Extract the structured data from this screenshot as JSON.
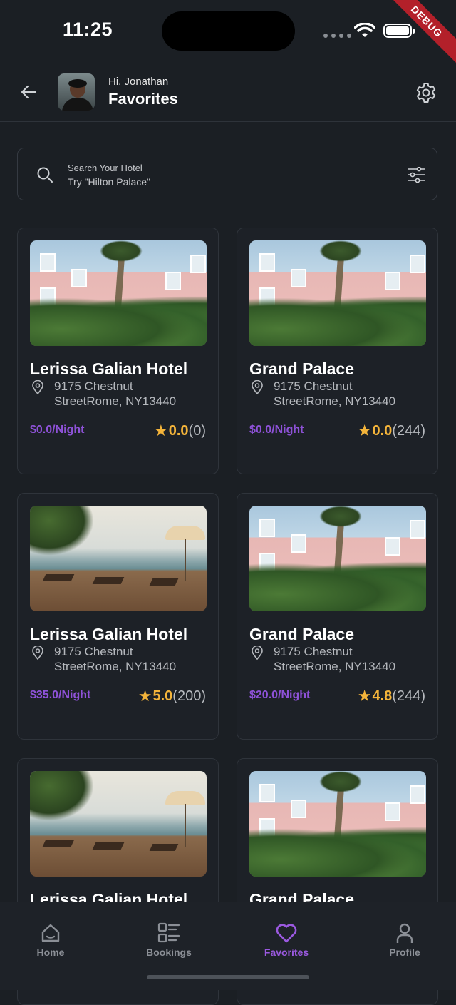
{
  "status_bar": {
    "time": "11:25",
    "debug_label": "DEBUG"
  },
  "header": {
    "greeting": "Hi, Jonathan",
    "title": "Favorites"
  },
  "search": {
    "label": "Search Your Hotel",
    "placeholder": "Try \"Hilton Palace\""
  },
  "hotels": [
    {
      "name": "Lerissa Galian Hotel",
      "address_line1": "9175 Chestnut",
      "address_line2": "StreetRome, NY13440",
      "price": "$0.0/Night",
      "rating": "0.0",
      "reviews": "(0)",
      "image": "pink-hotel"
    },
    {
      "name": "Grand Palace",
      "address_line1": "9175 Chestnut",
      "address_line2": "StreetRome, NY13440",
      "price": "$0.0/Night",
      "rating": "0.0",
      "reviews": "(244)",
      "image": "pink-hotel"
    },
    {
      "name": "Lerissa Galian Hotel",
      "address_line1": "9175 Chestnut",
      "address_line2": "StreetRome, NY13440",
      "price": "$35.0/Night",
      "rating": "5.0",
      "reviews": "(200)",
      "image": "beach-deck"
    },
    {
      "name": "Grand Palace",
      "address_line1": "9175 Chestnut",
      "address_line2": "StreetRome, NY13440",
      "price": "$20.0/Night",
      "rating": "4.8",
      "reviews": "(244)",
      "image": "pink-hotel"
    },
    {
      "name": "Lerissa Galian Hotel",
      "image": "beach-deck"
    },
    {
      "name": "Grand Palace",
      "image": "pink-hotel"
    }
  ],
  "nav": {
    "home": "Home",
    "bookings": "Bookings",
    "favorites": "Favorites",
    "profile": "Profile",
    "active": "favorites"
  },
  "colors": {
    "accent": "#9b59e0",
    "price": "#8e52d8",
    "star": "#f4b43a",
    "background": "#1b1f24"
  }
}
